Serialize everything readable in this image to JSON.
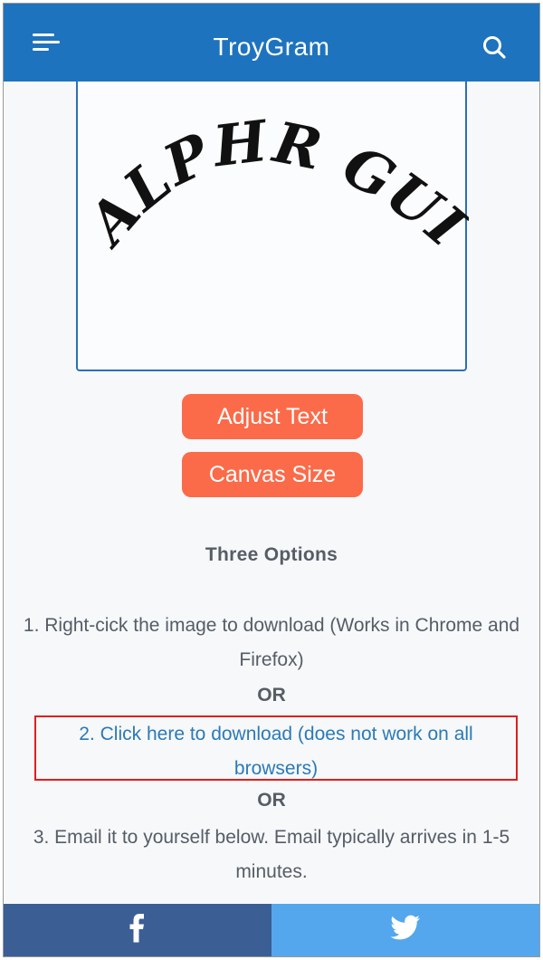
{
  "header": {
    "title": "TroyGram"
  },
  "canvas": {
    "curved_text": "ALPHR GUIDES"
  },
  "buttons": {
    "adjust_text": "Adjust Text",
    "canvas_size": "Canvas Size"
  },
  "options": {
    "title": "Three Options",
    "option1": "1. Right-cick the image to download (Works in Chrome and Firefox)",
    "or1": "OR",
    "option2_link": "2. Click here to download (does not work on all browsers)",
    "or2": "OR",
    "option3": "3. Email it to yourself below. Email typically arrives in 1-5 minutes."
  },
  "footer": {
    "facebook_icon": "facebook-icon",
    "twitter_icon": "twitter-icon"
  },
  "colors": {
    "header_bg": "#1e73be",
    "button_bg": "#fb6b49",
    "link": "#2a7ab8",
    "highlight_border": "#e21d1d",
    "facebook": "#3b5e95",
    "twitter": "#54a7ec"
  }
}
